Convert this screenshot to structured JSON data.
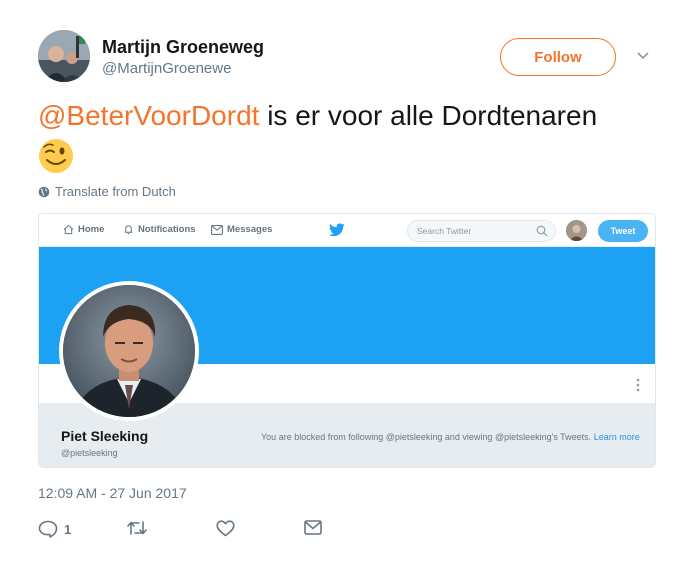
{
  "author": {
    "name": "Martijn Groeneweg",
    "handle": "@MartijnGroenewe",
    "follow_label": "Follow"
  },
  "tweet": {
    "mention": "@BeterVoorDordt",
    "text": " is er voor alle Dordtenaren",
    "emoji": "winking-face",
    "translate_label": "Translate from Dutch",
    "timestamp": "12:09 AM - 27 Jun 2017",
    "reply_count": "1"
  },
  "embedded_screenshot": {
    "nav": {
      "home": "Home",
      "notifications": "Notifications",
      "messages": "Messages",
      "search_placeholder": "Search Twitter",
      "tweet_button": "Tweet"
    },
    "profile": {
      "name": "Piet Sleeking",
      "handle": "@pietsleeking",
      "blocked_text": "You are blocked from following @pietsleeking and viewing @pietsleeking's Tweets. ",
      "learn_more": "Learn more"
    }
  },
  "colors": {
    "accent": "#f4742b",
    "banner": "#1da1f2",
    "secondary_text": "#657786",
    "link": "#1b95e0"
  }
}
